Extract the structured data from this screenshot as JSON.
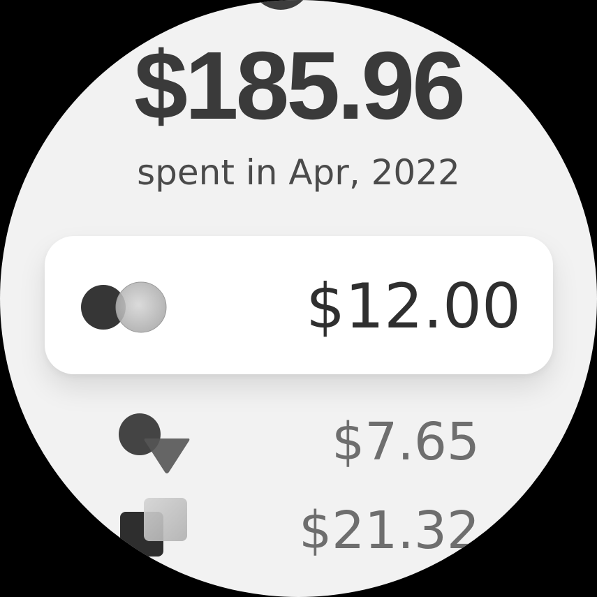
{
  "summary": {
    "total_amount": "$185.96",
    "period_label": "spent in Apr, 2022"
  },
  "selected_row": {
    "icon": "mastercard-icon",
    "amount": "$12.00"
  },
  "rows": [
    {
      "icon": "circle-triangle-icon",
      "amount": "$7.65"
    },
    {
      "icon": "overlapping-squares-icon",
      "amount": "$21.32"
    }
  ],
  "colors": {
    "face_background": "#f2f2f2",
    "card_background": "#ffffff",
    "primary_text": "#3a3a3a",
    "secondary_text": "#6e6e6e"
  }
}
